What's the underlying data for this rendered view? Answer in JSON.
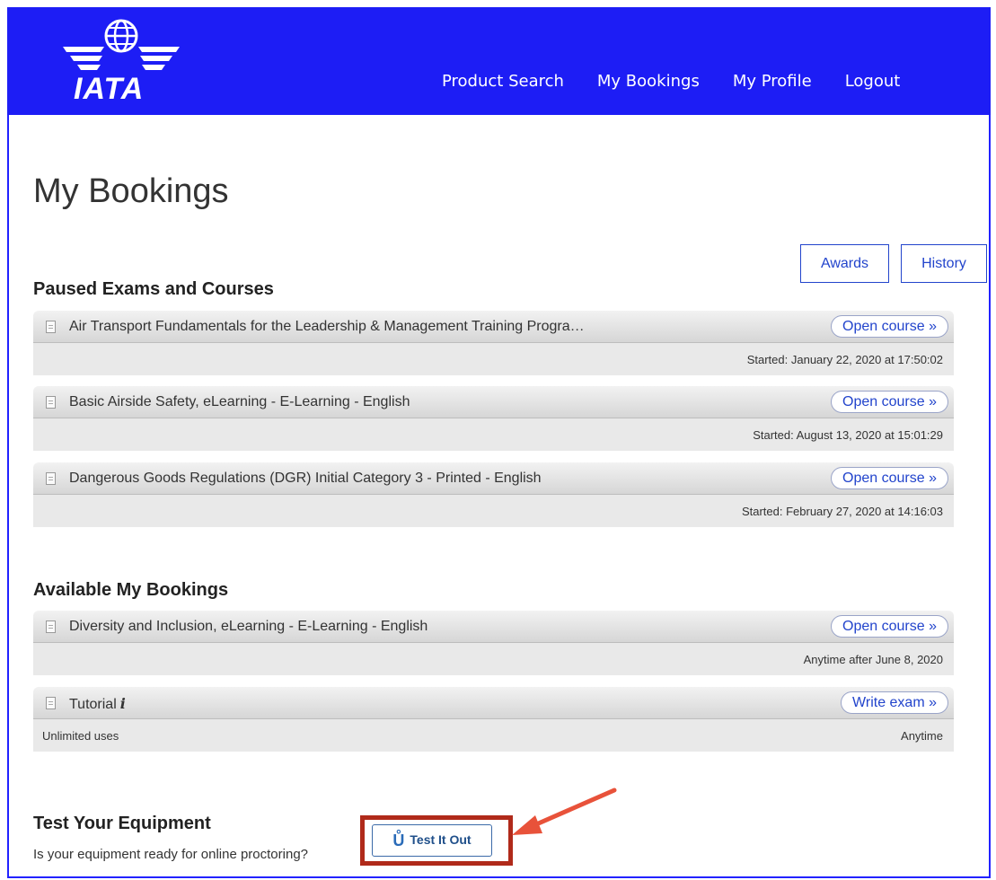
{
  "header": {
    "logo_text": "IATA",
    "nav": [
      "Product Search",
      "My Bookings",
      "My Profile",
      "Logout"
    ]
  },
  "page_title": "My Bookings",
  "buttons": {
    "awards": "Awards",
    "history": "History"
  },
  "paused": {
    "title": "Paused Exams and Courses",
    "items": [
      {
        "title": "Air Transport Fundamentals for the Leadership & Management Training Progra…",
        "action": "Open course »",
        "meta": "Started: January 22, 2020 at 17:50:02"
      },
      {
        "title": "Basic Airside Safety, eLearning - E-Learning - English",
        "action": "Open course »",
        "meta": "Started: August 13, 2020 at 15:01:29"
      },
      {
        "title": "Dangerous Goods Regulations (DGR) Initial Category 3 - Printed - English",
        "action": "Open course »",
        "meta": "Started: February 27, 2020 at 14:16:03"
      }
    ]
  },
  "available": {
    "title": "Available My Bookings",
    "items": [
      {
        "title": "Diversity and Inclusion, eLearning - E-Learning - English",
        "action": "Open course »",
        "meta": "Anytime after June 8, 2020"
      },
      {
        "title": "Tutorial",
        "info": "i",
        "action": "Write exam »",
        "meta_left": "Unlimited uses",
        "meta": "Anytime"
      }
    ]
  },
  "test_equipment": {
    "title": "Test Your Equipment",
    "description": "Is your equipment ready for online proctoring?",
    "button": "Test It Out"
  },
  "colors": {
    "header_bg": "#1d1df5",
    "link": "#2244cc",
    "highlight": "#b02a1a",
    "arrow": "#e8523a"
  }
}
